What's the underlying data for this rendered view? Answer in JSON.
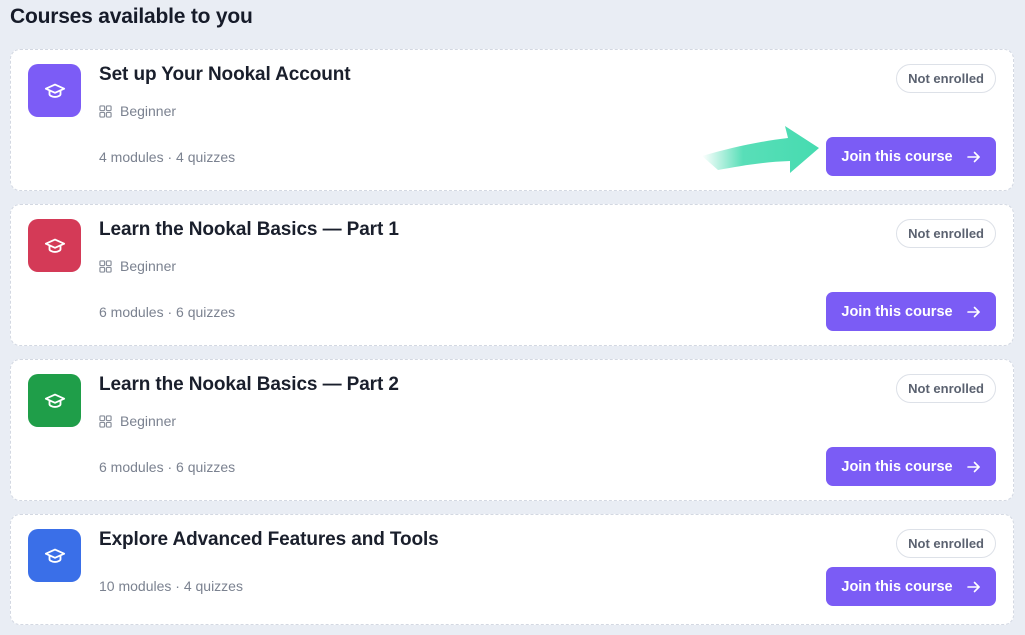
{
  "page": {
    "title": "Courses available to you"
  },
  "colors": {
    "accent": "#7b5cf5",
    "annotation_arrow": "#46dbb0",
    "icon_purple": "#7c5cf6",
    "icon_red": "#d43a57",
    "icon_green": "#1f9e49",
    "icon_blue": "#3a6fe8"
  },
  "courses": [
    {
      "title": "Set up Your Nookal Account",
      "level": "Beginner",
      "meta": "4 modules · 4 quizzes",
      "status": "Not enrolled",
      "button": "Join this course",
      "icon": "graduation-cap-icon",
      "icon_color": "#7c5cf6"
    },
    {
      "title": "Learn the Nookal Basics — Part 1",
      "level": "Beginner",
      "meta": "6 modules · 6 quizzes",
      "status": "Not enrolled",
      "button": "Join this course",
      "icon": "graduation-cap-icon",
      "icon_color": "#d43a57"
    },
    {
      "title": "Learn the Nookal Basics — Part 2",
      "level": "Beginner",
      "meta": "6 modules · 6 quizzes",
      "status": "Not enrolled",
      "button": "Join this course",
      "icon": "graduation-cap-icon",
      "icon_color": "#1f9e49"
    },
    {
      "title": "Explore Advanced Features and Tools",
      "meta": "10 modules · 4 quizzes",
      "status": "Not enrolled",
      "button": "Join this course",
      "icon": "graduation-cap-icon",
      "icon_color": "#3a6fe8"
    }
  ]
}
